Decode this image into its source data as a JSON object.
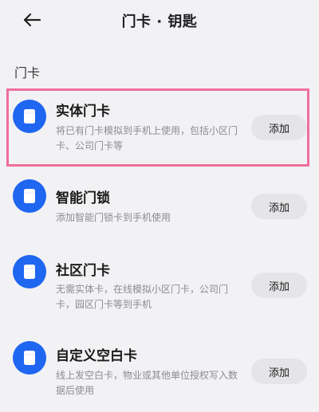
{
  "header": {
    "title": "门卡 · 钥匙",
    "back_icon": "arrow-left-icon"
  },
  "section": {
    "title": "门卡"
  },
  "items": [
    {
      "title": "实体门卡",
      "description": "将已有门卡模拟到手机上使用，包括小区门卡、公司门卡等",
      "button": "添加",
      "icon": "card-icon"
    },
    {
      "title": "智能门锁",
      "description": "添加智能门锁卡到手机使用",
      "button": "添加",
      "icon": "card-icon"
    },
    {
      "title": "社区门卡",
      "description": "无需实体卡，在线模拟小区门卡，公司门卡，园区门卡等到手机",
      "button": "添加",
      "icon": "card-icon"
    },
    {
      "title": "自定义空白卡",
      "description": "线上发空白卡，物业或其他单位授权写入数据后使用",
      "button": "添加",
      "icon": "card-icon"
    }
  ],
  "colors": {
    "background": "#f2f2f4",
    "icon_blue": "#1f66f0",
    "highlight": "#f06e9b",
    "button_bg": "#e5e5e8"
  }
}
